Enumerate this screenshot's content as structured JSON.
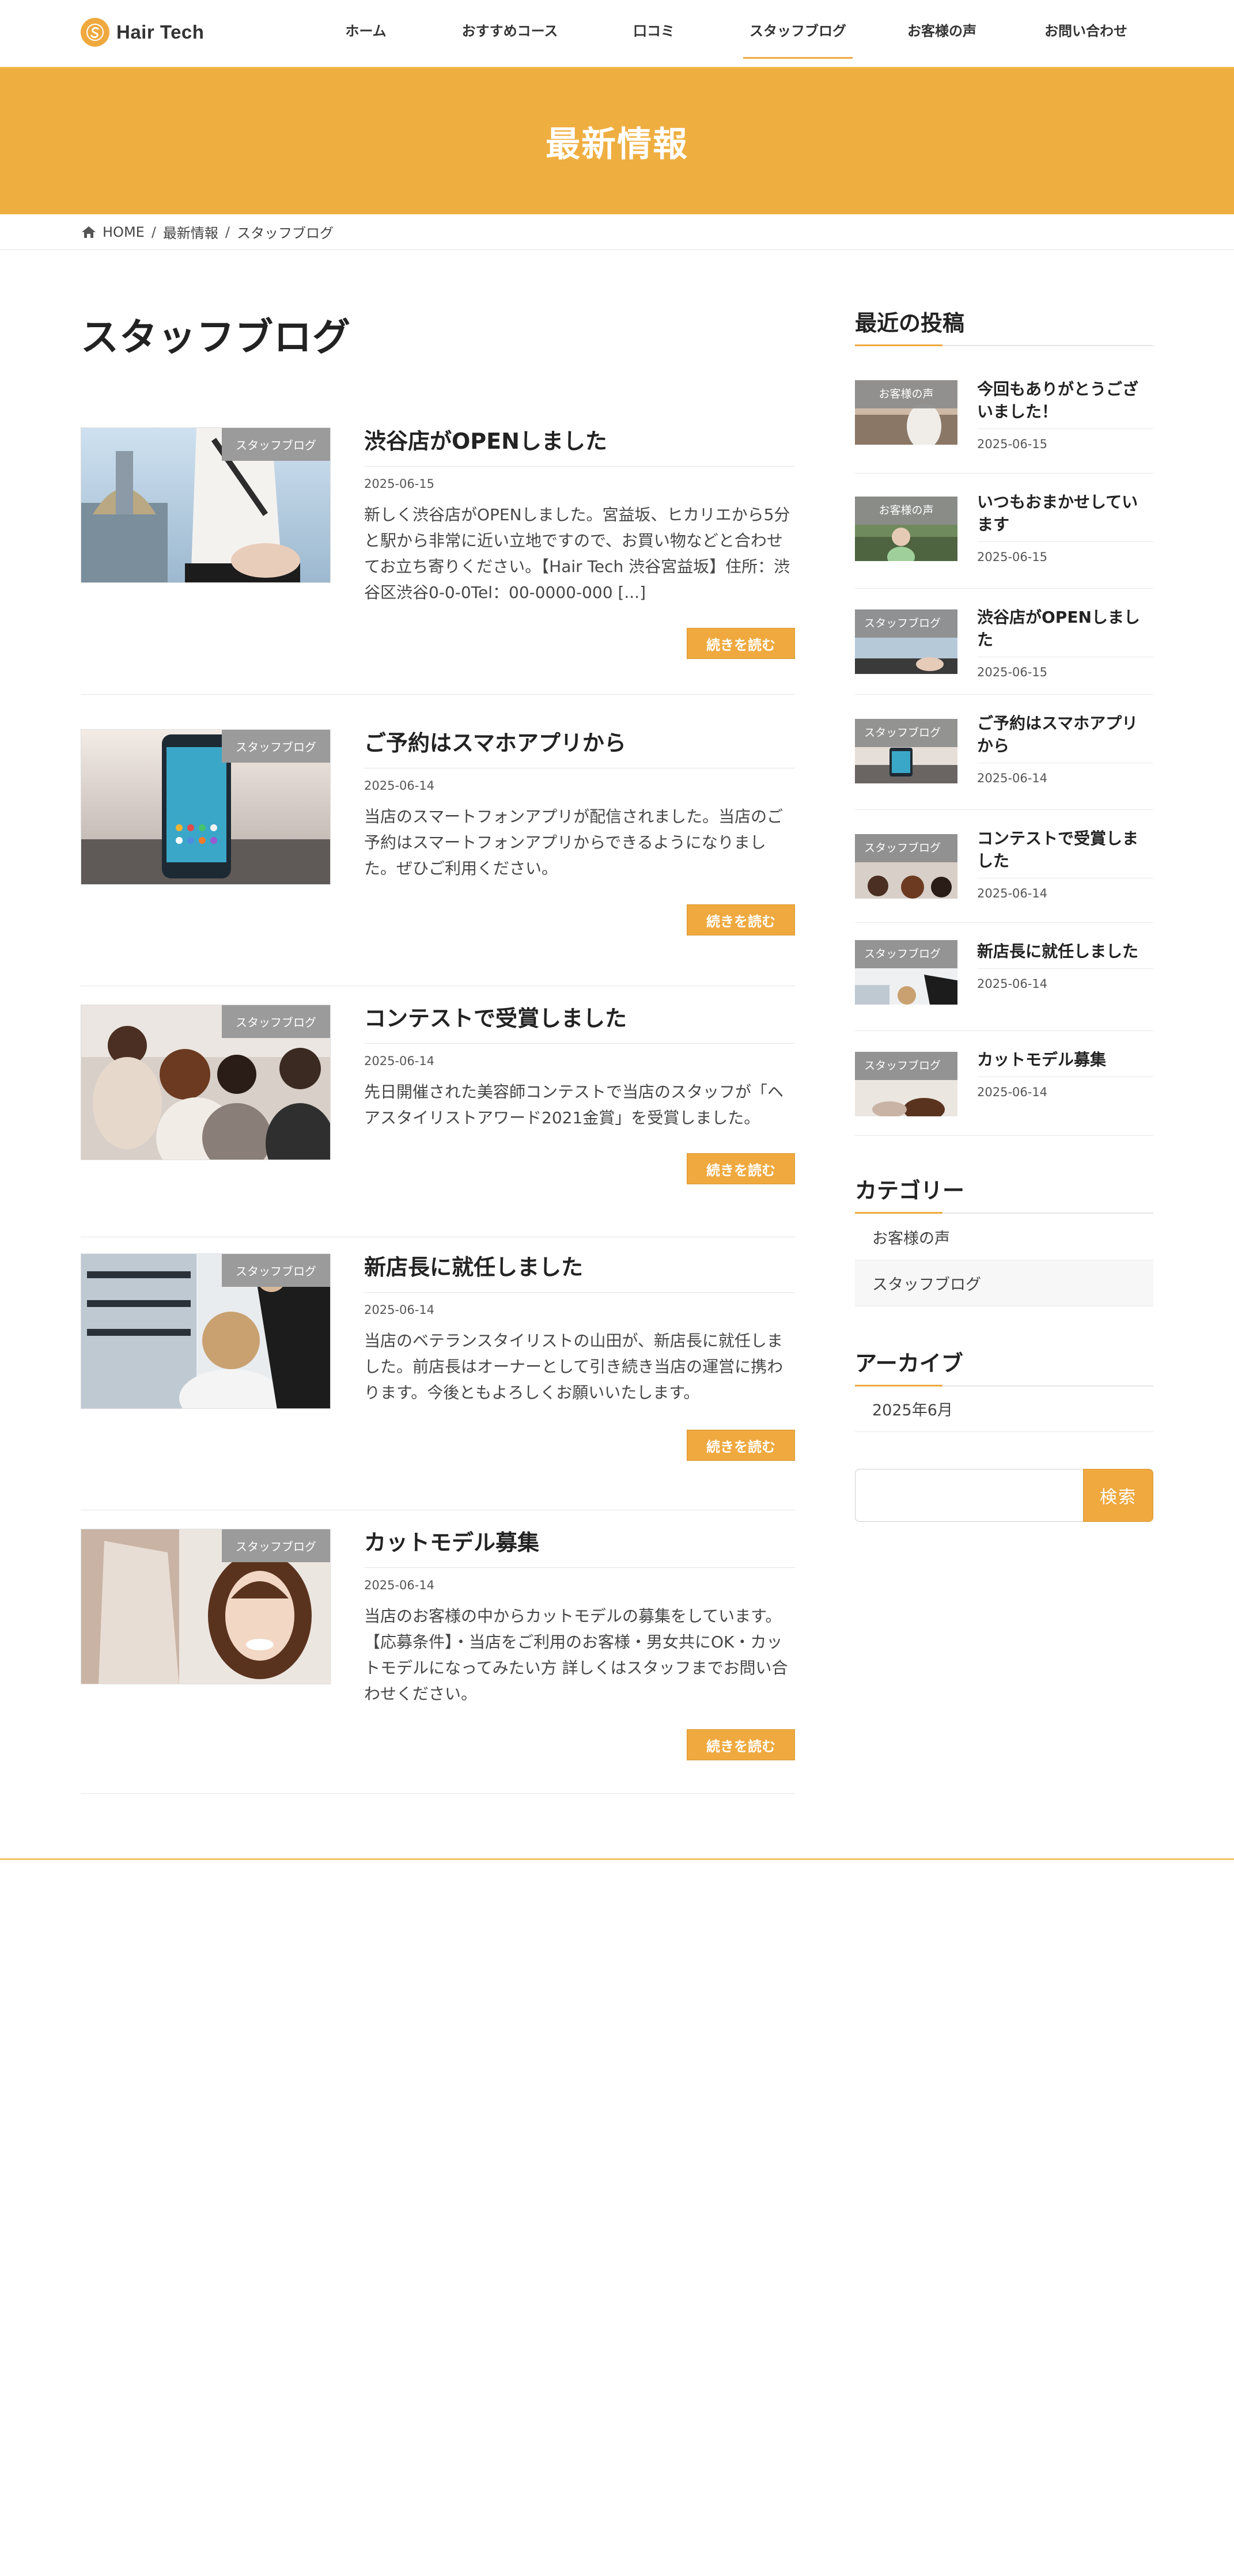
{
  "header": {
    "logo_text": "Hair Tech",
    "nav": [
      "ホーム",
      "おすすめコース",
      "口コミ",
      "スタッフブログ",
      "お客様の声",
      "お問い合わせ"
    ],
    "active_index": 3
  },
  "page_title": "最新情報",
  "breadcrumb": {
    "home": "HOME",
    "level1": "最新情報",
    "current": "スタッフブログ"
  },
  "archive_title": "スタッフブログ",
  "posts": [
    {
      "category": "スタッフブログ",
      "title": "渋谷店がOPENしました",
      "date": "2025-06-15",
      "excerpt": "新しく渋谷店がOPENしました。宮益坂、ヒカリエから5分と駅から非常に近い立地ですので、お買い物などと合わせてお立ち寄りください。【Hair Tech 渋谷宮益坂】住所：渋谷区渋谷0-0-0Tel：00-0000-000 [...]",
      "read_more": "続きを読む"
    },
    {
      "category": "スタッフブログ",
      "title": "ご予約はスマホアプリから",
      "date": "2025-06-14",
      "excerpt": "当店のスマートフォンアプリが配信されました。当店のご予約はスマートフォンアプリからできるようになりました。ぜひご利用ください。",
      "read_more": "続きを読む"
    },
    {
      "category": "スタッフブログ",
      "title": "コンテストで受賞しました",
      "date": "2025-06-14",
      "excerpt": "先日開催された美容師コンテストで当店のスタッフが「ヘアスタイリストアワード2021金賞」を受賞しました。",
      "read_more": "続きを読む"
    },
    {
      "category": "スタッフブログ",
      "title": "新店長に就任しました",
      "date": "2025-06-14",
      "excerpt": "当店のベテランスタイリストの山田が、新店長に就任しました。前店長はオーナーとして引き続き当店の運営に携わります。今後ともよろしくお願いいたします。",
      "read_more": "続きを読む"
    },
    {
      "category": "スタッフブログ",
      "title": "カットモデル募集",
      "date": "2025-06-14",
      "excerpt": "当店のお客様の中からカットモデルの募集をしています。【応募条件】・当店をご利用のお客様・男女共にOK・カットモデルになってみたい方 詳しくはスタッフまでお問い合わせください。",
      "read_more": "続きを読む"
    }
  ],
  "sidebar": {
    "recent_title": "最近の投稿",
    "recent": [
      {
        "category": "お客様の声",
        "title": "今回もありがとうございました！",
        "date": "2025-06-15"
      },
      {
        "category": "お客様の声",
        "title": "いつもおまかせしています",
        "date": "2025-06-15"
      },
      {
        "category": "スタッフブログ",
        "title": "渋谷店がOPENしました",
        "date": "2025-06-15"
      },
      {
        "category": "スタッフブログ",
        "title": "ご予約はスマホアプリから",
        "date": "2025-06-14"
      },
      {
        "category": "スタッフブログ",
        "title": "コンテストで受賞しました",
        "date": "2025-06-14"
      },
      {
        "category": "スタッフブログ",
        "title": "新店長に就任しました",
        "date": "2025-06-14"
      },
      {
        "category": "スタッフブログ",
        "title": "カットモデル募集",
        "date": "2025-06-14"
      }
    ],
    "category_title": "カテゴリー",
    "categories": [
      "お客様の声",
      "スタッフブログ"
    ],
    "archive_title": "アーカイブ",
    "archives": [
      "2025年6月"
    ],
    "search_value": "",
    "search_button": "検索"
  },
  "colors": {
    "accent": "#efa93f",
    "band": "#efae40"
  }
}
